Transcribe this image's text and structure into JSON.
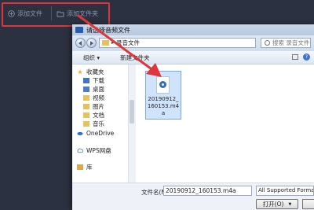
{
  "toolbar": {
    "add_file_label": "添加文件",
    "add_folder_label": "添加文件夹"
  },
  "dialog": {
    "title": "请选择音频文件",
    "address_path": "录音文件",
    "search_placeholder": "搜索 录音文件",
    "organize_label": "组织 ▾",
    "new_folder_label": "新建文件夹",
    "help_label": "?",
    "nav_items": [
      {
        "label": "收藏夹",
        "icon": "star-icon"
      },
      {
        "label": "下载",
        "icon": "download-folder-icon"
      },
      {
        "label": "桌面",
        "icon": "desktop-icon"
      },
      {
        "label": "视频",
        "icon": "video-folder-icon"
      },
      {
        "label": "图片",
        "icon": "picture-folder-icon"
      },
      {
        "label": "文档",
        "icon": "document-folder-icon"
      },
      {
        "label": "音乐",
        "icon": "music-folder-icon"
      },
      {
        "label": "OneDrive",
        "icon": "onedrive-icon"
      },
      {
        "label": "WPS网盘",
        "icon": "wps-cloud-icon"
      },
      {
        "label": "库",
        "icon": "library-icon"
      }
    ],
    "file": {
      "name": "20190912_160153.m4a",
      "icon": "audio-file-icon"
    },
    "filename_label": "文件名(N):",
    "filename_value": "20190912_160153.m4a",
    "filetype_value": "All Supported Formats",
    "open_label": "打开(O)"
  },
  "colors": {
    "app_background": "#2b3140",
    "highlight_border": "#e0353a",
    "arrow": "#e0353a",
    "selection": "#cfe3fb"
  }
}
